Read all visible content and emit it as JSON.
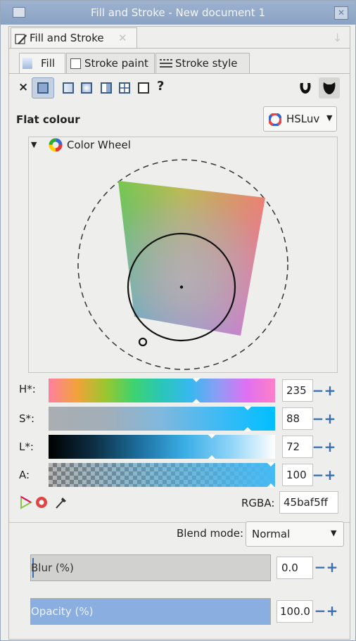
{
  "window": {
    "title": "Fill and Stroke - New document 1",
    "close_symbol": "✕"
  },
  "dock": {
    "panel_tab_label": "Fill and Stroke",
    "panel_tab_close": "✕",
    "dock_arrow": "↓"
  },
  "tabs": [
    {
      "label": "Fill",
      "active": true
    },
    {
      "label": "Stroke paint",
      "active": false
    },
    {
      "label": "Stroke style",
      "active": false
    }
  ],
  "paint_type": {
    "none_label": "×",
    "unset_label": "?",
    "buttons": [
      "flat-color-icon",
      "linear-gradient-icon",
      "radial-gradient-icon",
      "pattern-icon",
      "swatch-icon",
      "mesh-icon"
    ]
  },
  "fill_mode": {
    "label": "Flat colour",
    "picker_value": "HSLuv"
  },
  "color_wheel": {
    "expander_label": "Color Wheel"
  },
  "sliders": [
    {
      "label": "H*:",
      "value": "235",
      "thumb_fraction": 0.653
    },
    {
      "label": "S*:",
      "value": "88",
      "thumb_fraction": 0.88
    },
    {
      "label": "L*:",
      "value": "72",
      "thumb_fraction": 0.72
    },
    {
      "label": "A:",
      "value": "100",
      "thumb_fraction": 1.0
    }
  ],
  "rgba": {
    "label": "RGBA:",
    "value": "45baf5ff"
  },
  "blend": {
    "label": "Blend mode:",
    "value": "Normal"
  },
  "blur": {
    "label": "Blur (%)",
    "value": "0.0",
    "fraction": 0.0
  },
  "opacity": {
    "label": "Opacity (%)",
    "value": "100.0",
    "fraction": 1.0
  },
  "spin_minus": "−",
  "spin_plus": "+",
  "colors": {
    "accent": "#3b6db5",
    "rgba_color": "#45baf5",
    "opacity_bar": "#8aaee0"
  }
}
